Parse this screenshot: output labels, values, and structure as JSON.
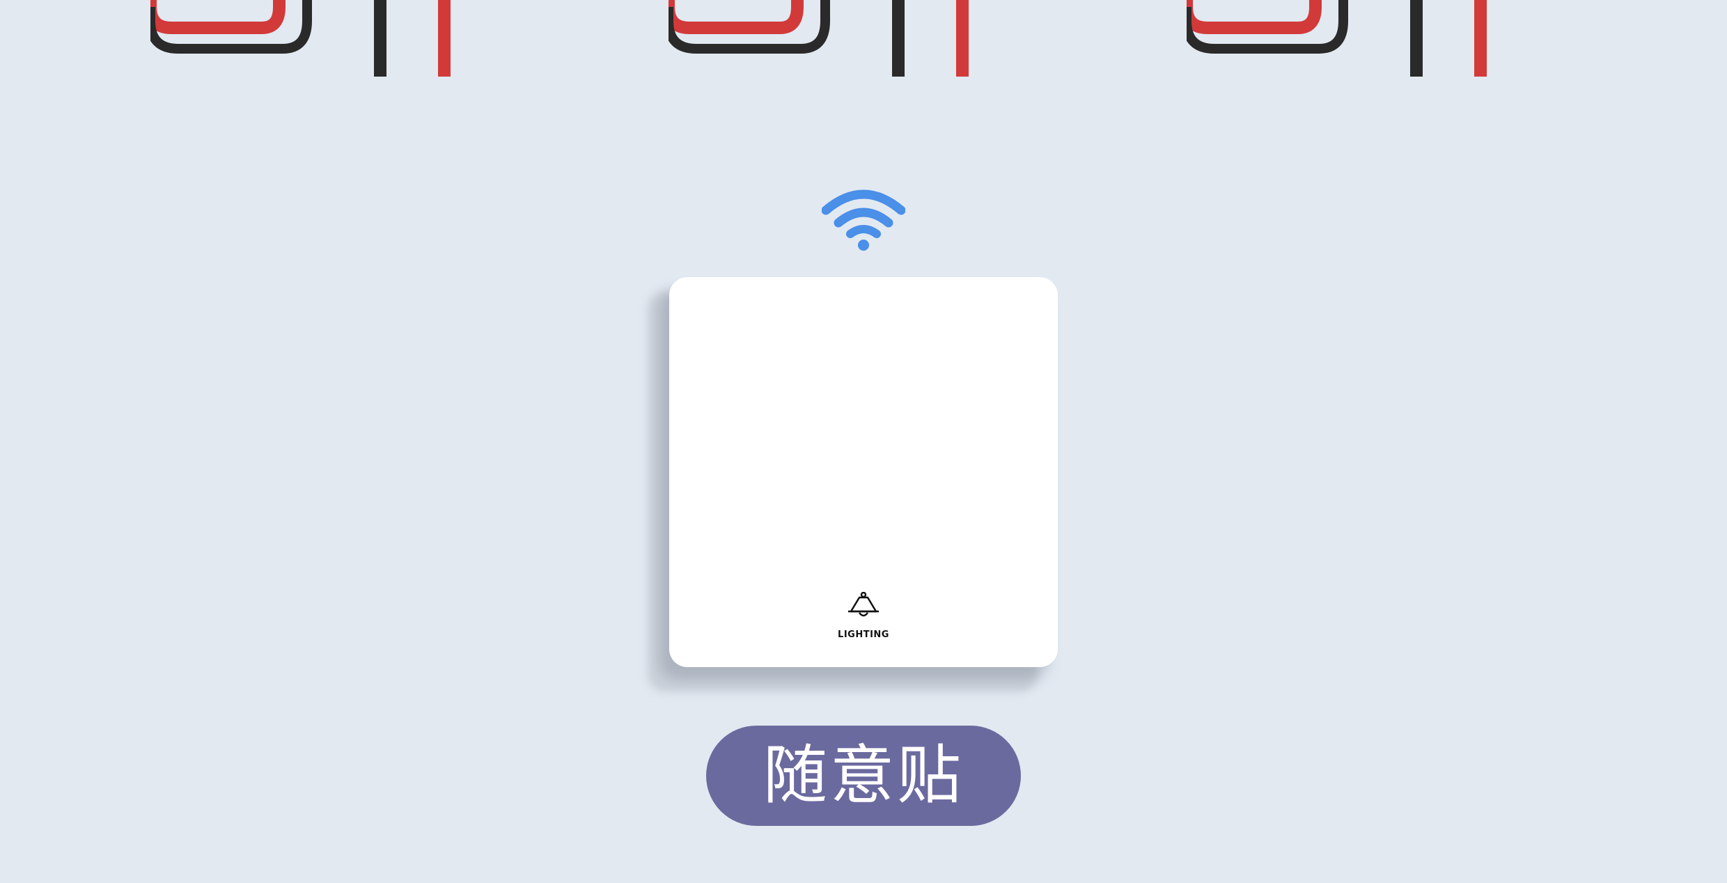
{
  "colors": {
    "background": "#e2e9f1",
    "wire_red": "#d23a3a",
    "wire_black": "#2a2a2a",
    "wifi": "#4a8fe8",
    "pill": "#6b6a9f"
  },
  "icons": {
    "signal": "wifi-icon",
    "switch_symbol": "lamp-icon"
  },
  "switch": {
    "label": "LIGHTING"
  },
  "tag": {
    "text": "随意贴"
  }
}
